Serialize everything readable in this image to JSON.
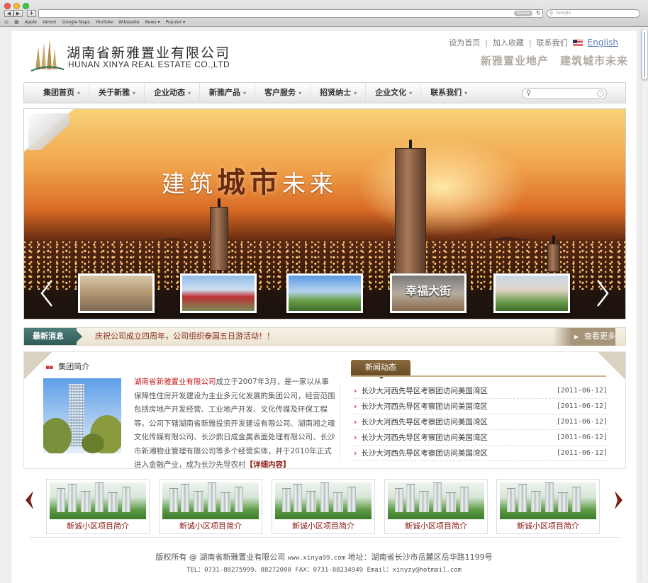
{
  "browser": {
    "reader_label": "Reader",
    "search_placeholder": "Google",
    "bookmarks": [
      "Apple",
      "Yahoo!",
      "Google Maps",
      "YouTube",
      "Wikipedia",
      "News ▾",
      "Popular ▾"
    ]
  },
  "header": {
    "company_cn": "湖南省新雅置业有限公司",
    "company_en": "HUNAN XINYA REAL ESTATE CO.,LTD",
    "links": [
      "设为首页",
      "加入收藏",
      "联系我们"
    ],
    "separator": "|",
    "english_label": "English",
    "slogan": "新雅置业地产　建筑城市未来"
  },
  "nav": {
    "items": [
      "集团首页",
      "关于新雅",
      "企业动态",
      "新雅产品",
      "客户服务",
      "招贤纳士",
      "企业文化",
      "联系我们"
    ],
    "caret": "▾"
  },
  "banner": {
    "title_part1": "建筑",
    "title_highlight": "城市",
    "title_part2": "未来",
    "thumb_caption": "幸福大街"
  },
  "ticker": {
    "label": "最新消息",
    "text": "庆祝公司成立四周年，公司组织泰国五日游活动！！",
    "more": "查看更多"
  },
  "intro": {
    "heading": "集团简介",
    "company_highlight": "湖南省新雅置业有限公司",
    "body": "成立于2007年3月，是一家以从事保障性住房开发建设为主业多元化发展的集团公司，经营范围包括房地产开发经营、工业地产开发、文化传媒及环保工程等。公司下辖湖南省新雅投资开发建设有限公司、湖南湘之魂文化传媒有限公司、长沙鼎日成金属表面处理有限公司、长沙市新湘物业管理有限公司等多个经营实体，并于2010年正式进入金融产业，成为长沙先导农村",
    "more": "【详细内容】"
  },
  "news": {
    "tab": "新闻动态",
    "items": [
      {
        "title": "长沙大河西先导区考察团访问美国湾区",
        "date": "[2011-06-12]"
      },
      {
        "title": "长沙大河西先导区考察团访问美国湾区",
        "date": "[2011-06-12]"
      },
      {
        "title": "长沙大河西先导区考察团访问美国湾区",
        "date": "[2011-06-12]"
      },
      {
        "title": "长沙大河西先导区考察团访问美国湾区",
        "date": "[2011-06-12]"
      },
      {
        "title": "长沙大河西先导区考察团访问美国湾区",
        "date": "[2011-06-12]"
      }
    ]
  },
  "projects": {
    "items": [
      "新诚小区项目简介",
      "新诚小区项目简介",
      "新诚小区项目简介",
      "新诚小区项目简介",
      "新诚小区项目简介"
    ]
  },
  "footer": {
    "line1_a": "版权所有 @ 湖南省新雅置业有限公司",
    "line1_site": "www.xinya99.com",
    "line1_b": "地址：湖南省长沙市岳麓区岳华路1199号",
    "line2": "TEL：0731-88275999、88272000 FAX：0731-88234949 Email：xinyzy@hotmail.com"
  },
  "colors": {
    "accent_red": "#8b1a10",
    "highlight_red": "#c21b1b",
    "ticker_green": "#2e5b56",
    "news_tab_brown": "#6a4c24"
  }
}
